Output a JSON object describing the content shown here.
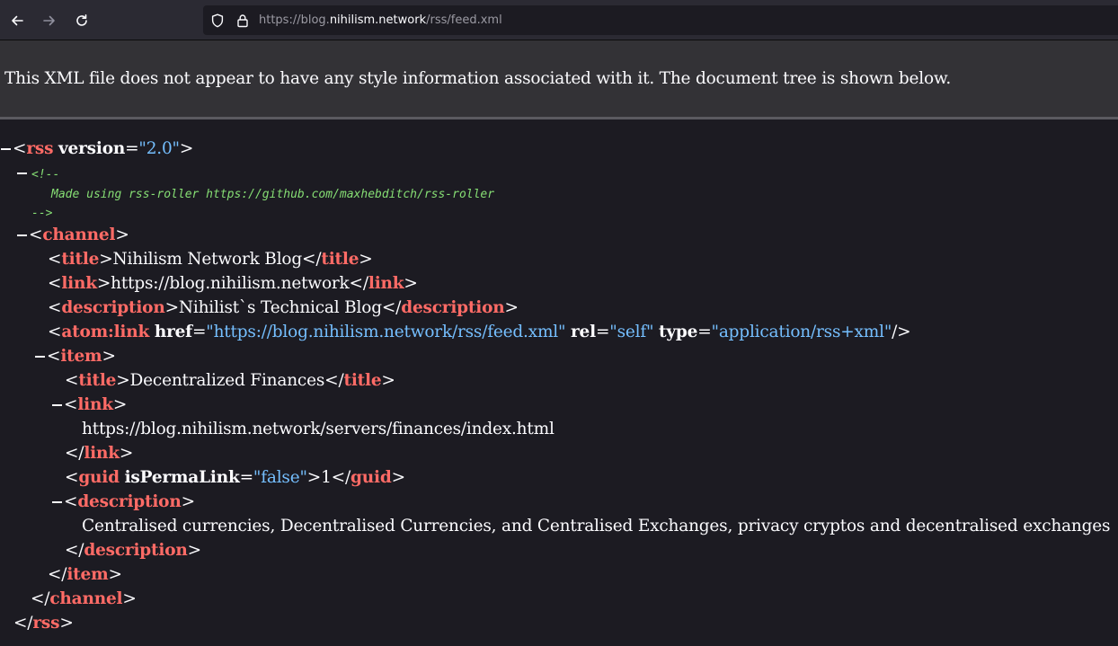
{
  "browser": {
    "url_prefix": "https://blog.",
    "url_host": "nihilism.network",
    "url_path": "/rss/feed.xml"
  },
  "notice": "This XML file does not appear to have any style information associated with it. The document tree is shown below.",
  "xml": {
    "rss_tag": "rss",
    "rss_attr": "version",
    "rss_version": "\"2.0\"",
    "comment_open": "<!--",
    "comment_text": "Made using rss-roller https://github.com/maxhebditch/rss-roller",
    "comment_close": "-->",
    "channel_tag": "channel",
    "title_tag": "title",
    "channel_title": "Nihilism Network Blog",
    "link_tag": "link",
    "channel_link": "https://blog.nihilism.network",
    "description_tag": "description",
    "channel_description": "Nihilist`s Technical Blog",
    "atom_tag": "atom:link",
    "atom_href_attr": "href",
    "atom_href": "\"https://blog.nihilism.network/rss/feed.xml\"",
    "atom_rel_attr": "rel",
    "atom_rel": "\"self\"",
    "atom_type_attr": "type",
    "atom_type": "\"application/rss+xml\"",
    "item_tag": "item",
    "item_title": "Decentralized Finances",
    "item_link": "https://blog.nihilism.network/servers/finances/index.html",
    "guid_tag": "guid",
    "guid_attr": "isPermaLink",
    "guid_attr_val": "\"false\"",
    "guid_value": "1",
    "item_description": "Centralised currencies, Decentralised Currencies, and Centralised Exchanges, privacy cryptos and decentralised exchanges"
  }
}
